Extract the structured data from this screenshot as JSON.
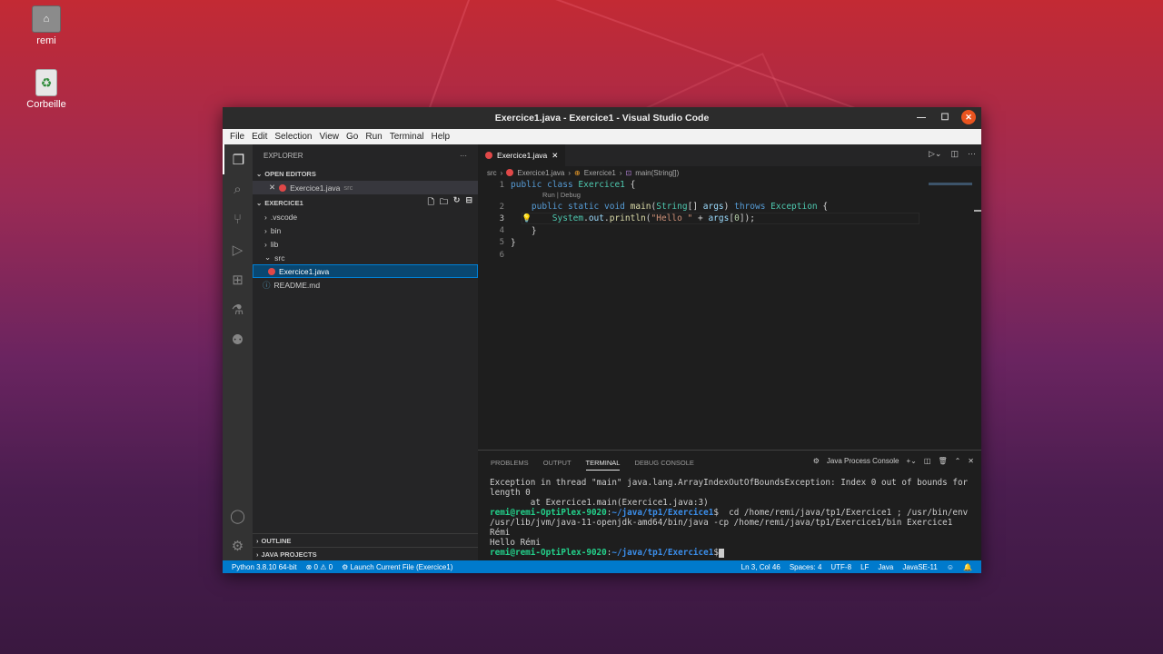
{
  "desktop": {
    "icons": [
      {
        "label": "remi",
        "icon": "home-folder-icon"
      },
      {
        "label": "Corbeille",
        "icon": "trash-icon"
      }
    ]
  },
  "window": {
    "title": "Exercice1.java - Exercice1 - Visual Studio Code",
    "menu": [
      "File",
      "Edit",
      "Selection",
      "View",
      "Go",
      "Run",
      "Terminal",
      "Help"
    ]
  },
  "sidebar": {
    "header": "EXPLORER",
    "more": "···",
    "open_editors_label": "OPEN EDITORS",
    "open_editor": {
      "name": "Exercice1.java",
      "hint": "src"
    },
    "project_label": "EXERCICE1",
    "tree": [
      {
        "name": ".vscode",
        "type": "folder"
      },
      {
        "name": "bin",
        "type": "folder"
      },
      {
        "name": "lib",
        "type": "folder"
      },
      {
        "name": "src",
        "type": "folder-open"
      },
      {
        "name": "Exercice1.java",
        "type": "file-java",
        "selected": true
      },
      {
        "name": "README.md",
        "type": "file-md"
      }
    ],
    "outline_label": "OUTLINE",
    "java_projects_label": "JAVA PROJECTS"
  },
  "editor": {
    "tab": "Exercice1.java",
    "breadcrumb": [
      "src",
      "Exercice1.java",
      "Exercice1",
      "main(String[])"
    ],
    "codelens": "Run | Debug",
    "current_line": 3
  },
  "panel": {
    "tabs": [
      "PROBLEMS",
      "OUTPUT",
      "TERMINAL",
      "DEBUG CONSOLE"
    ],
    "active_tab": "TERMINAL",
    "terminal_select": "Java Process Console",
    "terminal": {
      "exception": "Exception in thread \"main\" java.lang.ArrayIndexOutOfBoundsException: Index 0 out of bounds for length 0",
      "stack": "        at Exercice1.main(Exercice1.java:3)",
      "prompt_user": "remi@remi-OptiPlex-9020",
      "prompt_path": "~/java/tp1/Exercice1",
      "command": "  cd /home/remi/java/tp1/Exercice1 ; /usr/bin/env /usr/lib/jvm/java-11-openjdk-amd64/bin/java -cp /home/remi/java/tp1/Exercice1/bin Exercice1 Rémi",
      "output": "Hello Rémi"
    }
  },
  "statusbar": {
    "python": "Python 3.8.10 64-bit",
    "problems": "⊗ 0 ⚠ 0",
    "launch": "Launch Current File (Exercice1)",
    "position": "Ln 3, Col 46",
    "spaces": "Spaces: 4",
    "encoding": "UTF-8",
    "eol": "LF",
    "language": "Java",
    "jdk": "JavaSE-11"
  }
}
